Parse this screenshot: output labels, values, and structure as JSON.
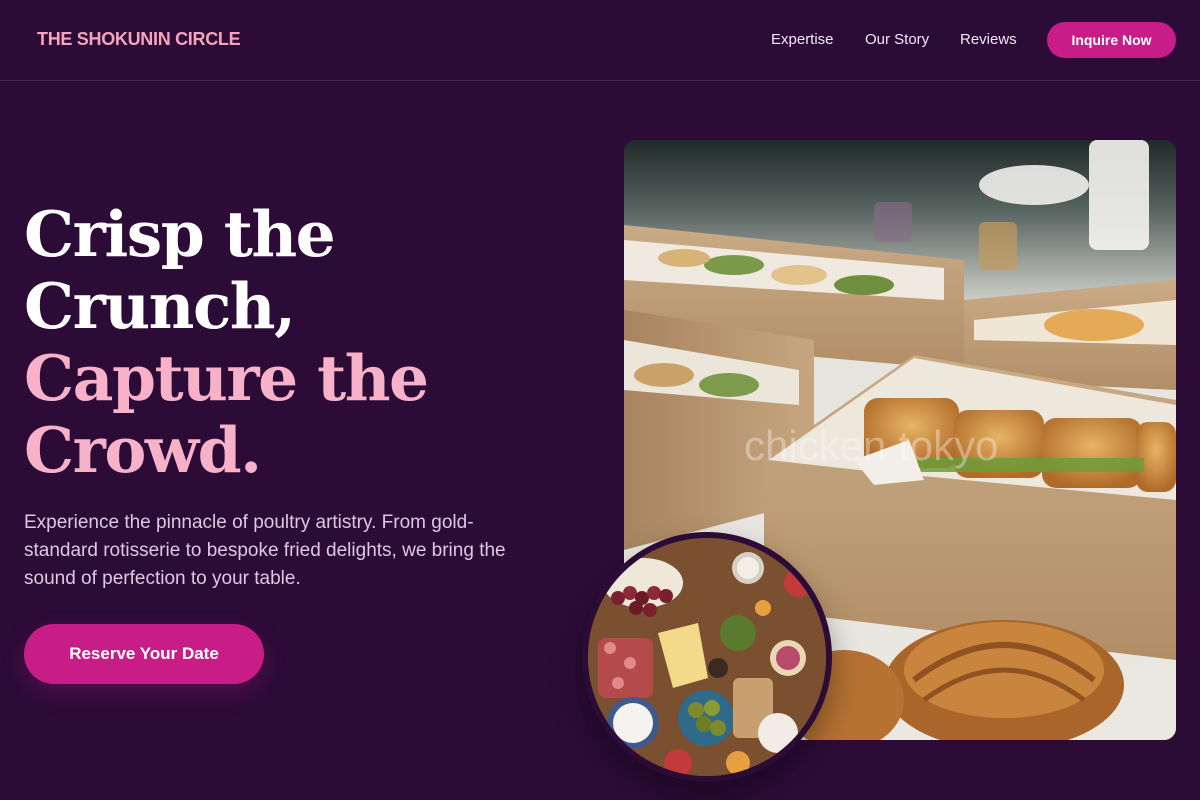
{
  "nav": {
    "brand": "THE SHOKUNIN CIRCLE",
    "links": [
      "Expertise",
      "Our Story",
      "Reviews"
    ],
    "cta": "Inquire Now"
  },
  "hero": {
    "title_lines": [
      "Crisp the",
      "Crunch,",
      "Capture the",
      "Crowd."
    ],
    "description": "Experience the pinnacle of poultry artistry. From gold-standard rotisserie to bespoke fried delights, we bring the sound of perfection to your table.",
    "cta": "Reserve Your Date"
  },
  "images": {
    "main_watermark": "chicken tokyo"
  },
  "colors": {
    "background": "#2c0b37",
    "accent": "#c81d87",
    "pink_text": "#f7b1c8",
    "brand": "#f6a3bd"
  }
}
